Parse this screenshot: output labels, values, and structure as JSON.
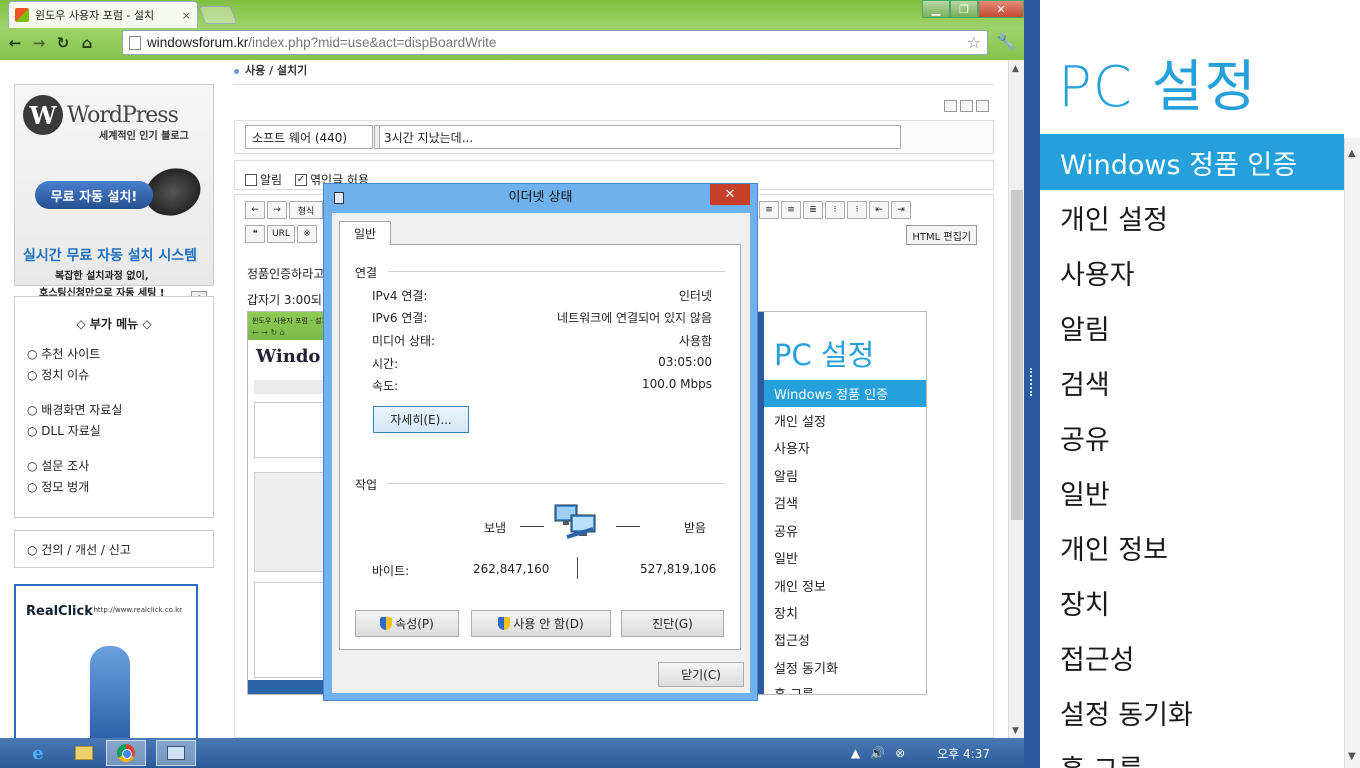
{
  "browser": {
    "tab_title": "윈도우 사용자 포럼 - 설치",
    "tab_close": "×",
    "url_host": "windowsforum.kr",
    "url_path": "/index.php?mid=use&act=dispBoardWrite"
  },
  "page": {
    "breadcrumb": "사용 / 설치기",
    "category": "소프트 웨어 (440)",
    "post_title": "3시간 지났는데...",
    "opt_notify": "알림",
    "opt_trackback": "엮인글 허용",
    "editor_line1": "정품인증하라고",
    "editor_line2": "갑자기 3:00되니",
    "html_editor": "HTML 편집기",
    "toolbar_format": "형식",
    "toolbar_url": "URL",
    "sidebar": {
      "ad_title": "WordPress",
      "ad_sub": "세계적인 인기 블로그",
      "ad_button": "무료 자동 설치!",
      "ad_big": "실시간 무료 자동 설치 시스템",
      "ad_s1": "복잡한 설치과정 없이,",
      "ad_s2": "호스팅신청만으로 자동 세팅 !",
      "menu_title": "◇ 부가 메뉴 ◇",
      "menu_items": [
        "○ 추천 사이트",
        "○ 정치 이슈",
        "○ 배경화면 자료실",
        "○ DLL 자료실",
        "○ 설문 조사",
        "○ 정모 벙개"
      ],
      "report": "○ 건의 / 개선 / 신고",
      "realclick": "RealClick",
      "realclick_url": "http://www.realclick.co.kr"
    },
    "embedded": {
      "pc_title": "PC 설정",
      "pc_items": [
        "Windows 정품 인증",
        "개인 설정",
        "사용자",
        "알림",
        "검색",
        "공유",
        "일반",
        "개인 정보",
        "장치",
        "접근성",
        "설정 동기화",
        "홈 그룹"
      ]
    }
  },
  "dialog": {
    "title": "이더넷 상태",
    "close": "✕",
    "tab": "일반",
    "section_conn": "연결",
    "ipv4_label": "IPv4 연결:",
    "ipv4_value": "인터넷",
    "ipv6_label": "IPv6 연결:",
    "ipv6_value": "네트워크에 연결되어 있지 않음",
    "media_label": "미디어 상태:",
    "media_value": "사용함",
    "time_label": "시간:",
    "time_value": "03:05:00",
    "speed_label": "속도:",
    "speed_value": "100.0 Mbps",
    "details_btn": "자세히(E)...",
    "section_act": "작업",
    "sent_label": "보냄",
    "recv_label": "받음",
    "bytes_label": "바이트:",
    "bytes_sent": "262,847,160",
    "bytes_recv": "527,819,106",
    "props_btn": "속성(P)",
    "disable_btn": "사용 안 함(D)",
    "diag_btn": "진단(G)",
    "close_btn": "닫기(C)"
  },
  "taskbar": {
    "time": "오후 4:37"
  },
  "pcsettings": {
    "title": "PC 설정",
    "items": [
      "Windows 정품 인증",
      "개인 설정",
      "사용자",
      "알림",
      "검색",
      "공유",
      "일반",
      "개인 정보",
      "장치",
      "접근성",
      "설정 동기화",
      "홈 그룹"
    ],
    "selected": "Windows 정품 인증",
    "accent": "#26a0da"
  }
}
